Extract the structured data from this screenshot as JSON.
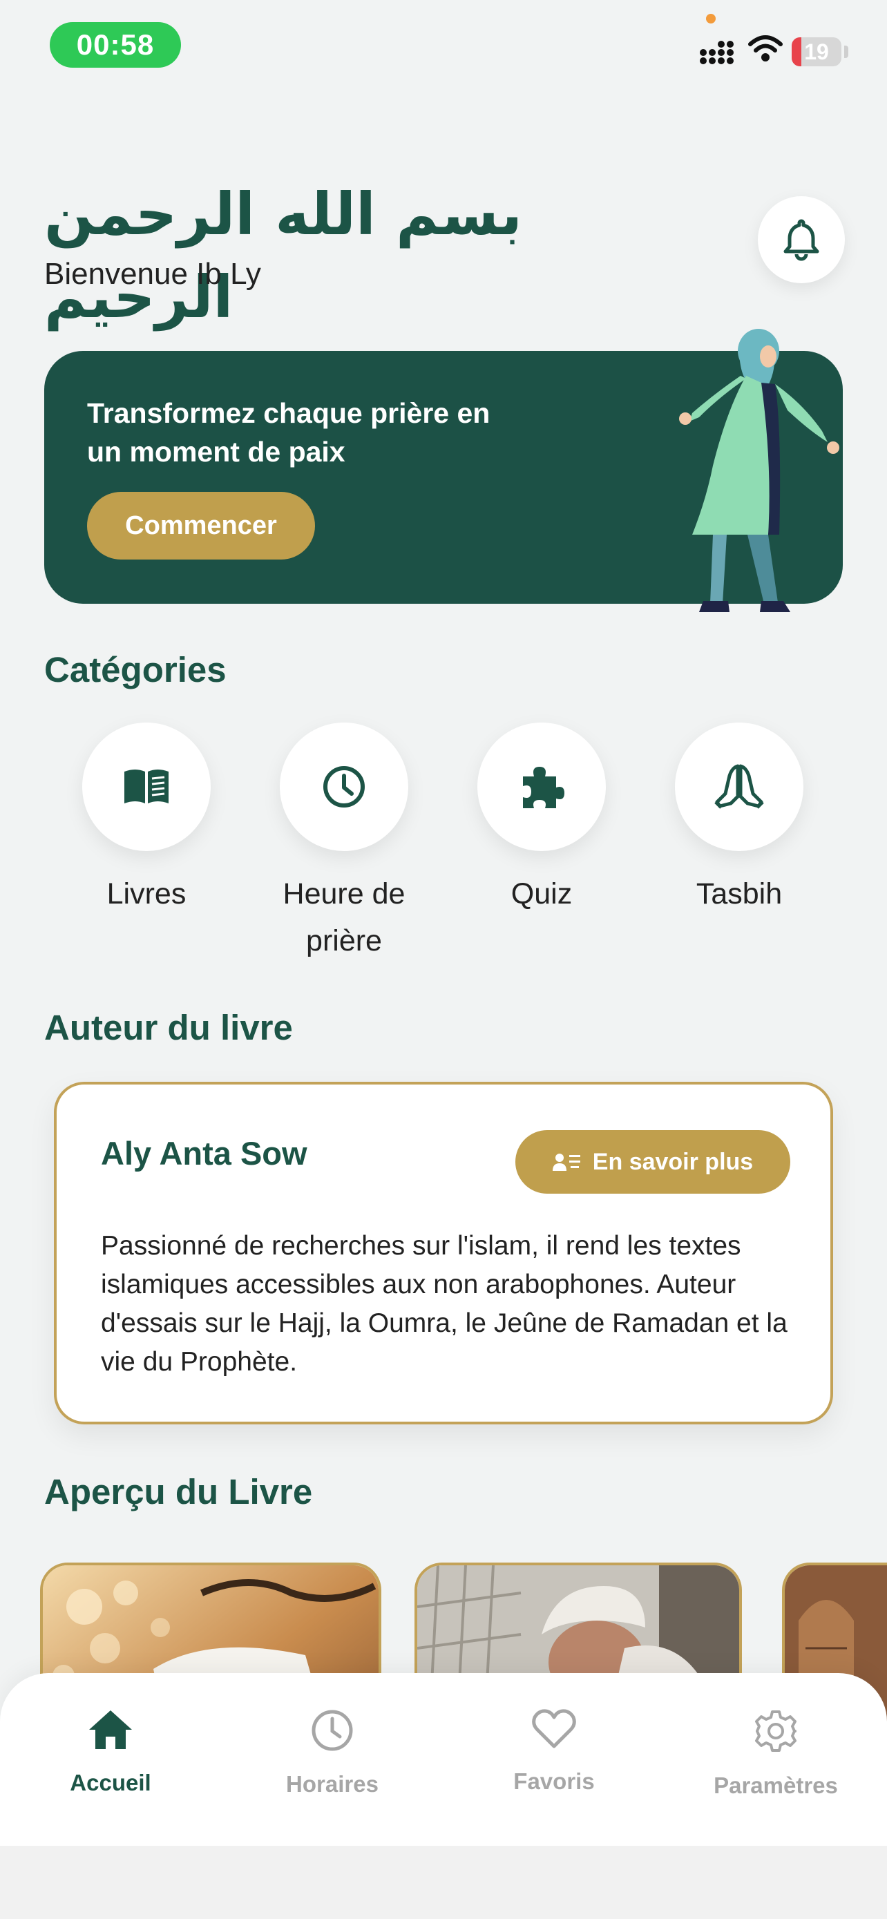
{
  "status_bar": {
    "time": "00:58",
    "battery_level": "19",
    "battery_fraction": 0.19
  },
  "header": {
    "basmala": "بسم الله الرحمن الرحيم",
    "welcome": "Bienvenue Ib Ly"
  },
  "hero": {
    "title": "Transformez chaque prière en un moment de paix",
    "button_label": "Commencer"
  },
  "categories": {
    "title": "Catégories",
    "items": [
      {
        "label": "Livres",
        "icon": "book-icon"
      },
      {
        "label": "Heure de prière",
        "icon": "clock-icon"
      },
      {
        "label": "Quiz",
        "icon": "puzzle-icon"
      },
      {
        "label": "Tasbih",
        "icon": "praying-hands-icon"
      }
    ]
  },
  "author": {
    "section_title": "Auteur du livre",
    "name": "Aly Anta Sow",
    "button_label": "En savoir plus",
    "bio": "Passionné de recherches sur l'islam, il rend les textes islamiques accessibles aux non arabophones. Auteur d'essais sur le Hajj, la Oumra, le Jeûne de Ramadan et la vie du Prophète."
  },
  "book_preview": {
    "section_title": "Aperçu du Livre"
  },
  "bottom_nav": {
    "items": [
      {
        "label": "Accueil",
        "icon": "home-icon",
        "active": true
      },
      {
        "label": "Horaires",
        "icon": "clock-icon",
        "active": false
      },
      {
        "label": "Favoris",
        "icon": "heart-icon",
        "active": false
      },
      {
        "label": "Paramètres",
        "icon": "gear-icon",
        "active": false
      }
    ]
  },
  "colors": {
    "primary": "#1c5446",
    "accent": "#c09f4d",
    "background": "#f1f3f3"
  }
}
